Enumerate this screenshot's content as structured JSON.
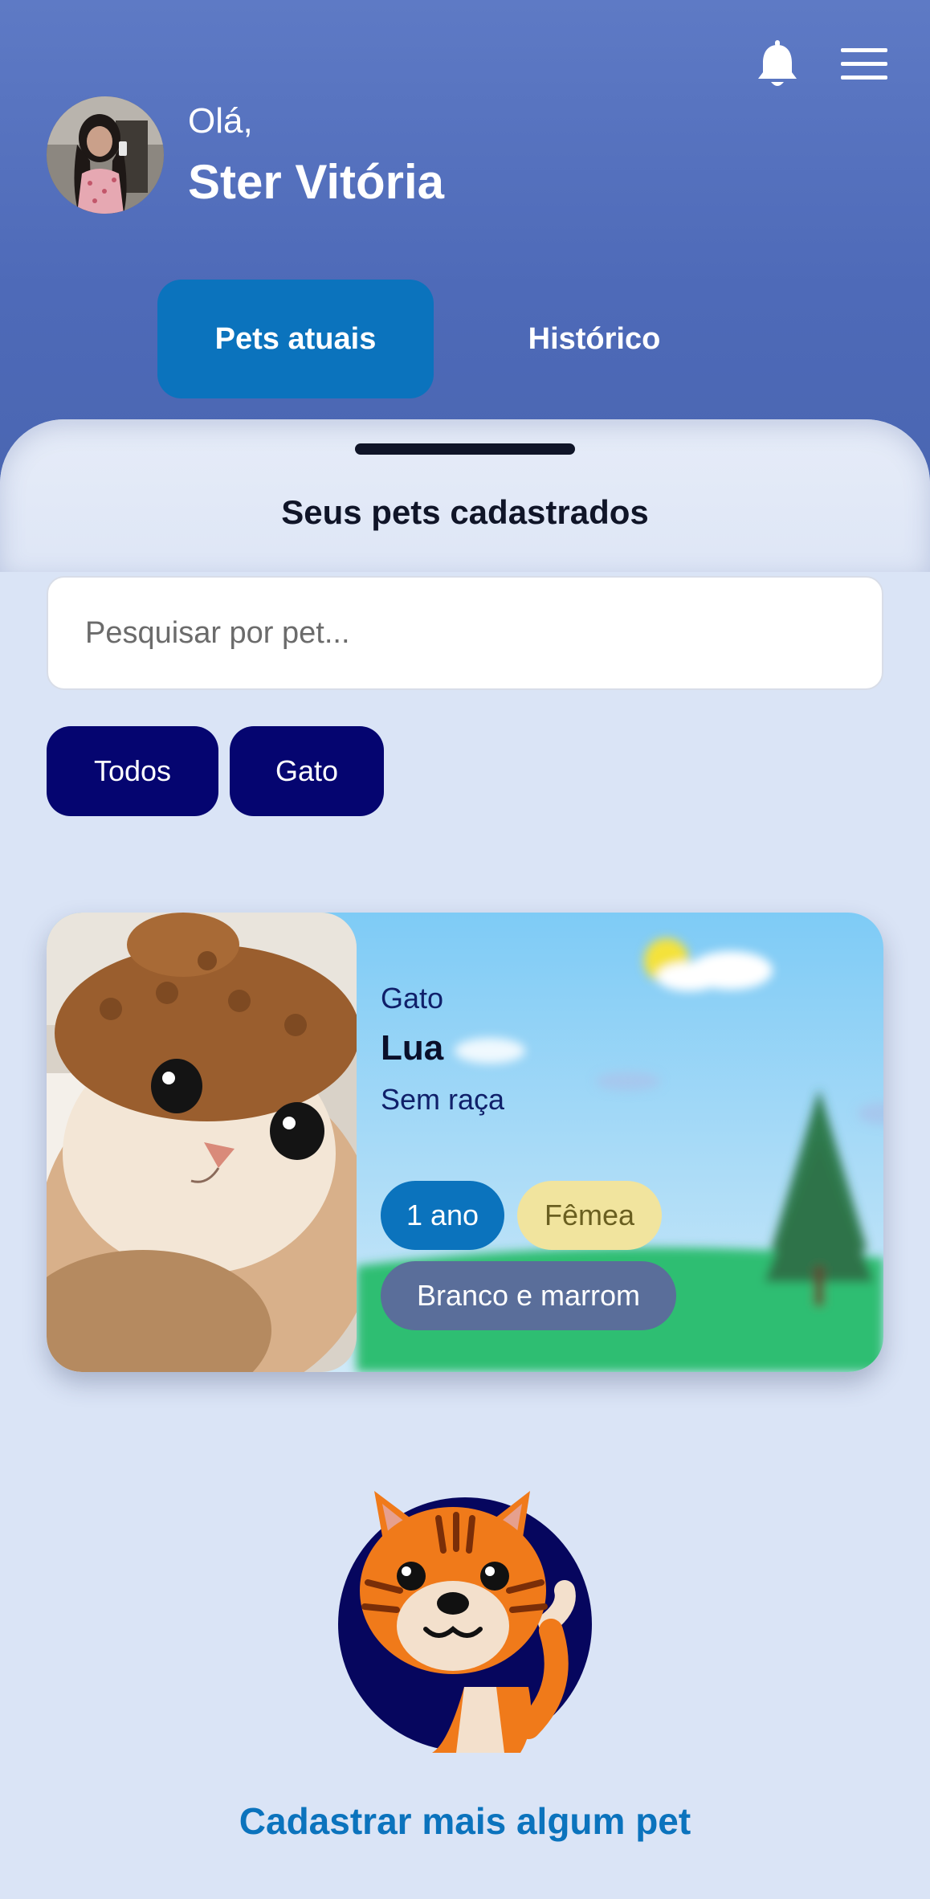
{
  "header": {
    "greeting": "Olá,",
    "user_name": "Ster Vitória",
    "bell_icon": "bell-icon",
    "menu_icon": "hamburger-menu-icon"
  },
  "tabs": [
    {
      "label": "Pets atuais",
      "active": true
    },
    {
      "label": "Histórico",
      "active": false
    }
  ],
  "sheet": {
    "title": "Seus pets cadastrados",
    "search_placeholder": "Pesquisar por pet...",
    "filters": [
      "Todos",
      "Gato"
    ]
  },
  "pet_card": {
    "species": "Gato",
    "name": "Lua",
    "breed": "Sem raça",
    "age": "1 ano",
    "sex": "Fêmea",
    "color": "Branco e marrom"
  },
  "cta": "Cadastrar mais algum pet",
  "colors": {
    "header": "#5e7ac5",
    "primary": "#0b73bd",
    "chip": "#050570",
    "background": "#dae4f6",
    "sex_pill": "#f1e49e",
    "color_pill": "#5a6e9a"
  }
}
